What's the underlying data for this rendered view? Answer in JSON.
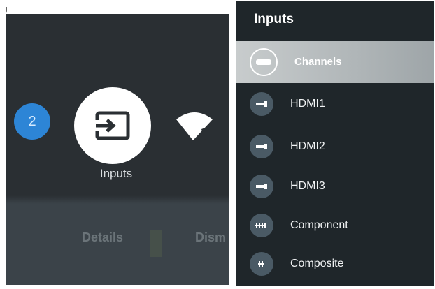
{
  "left_panel": {
    "badge_count": "2",
    "inputs_label": "Inputs",
    "details_label": "Details",
    "dismiss_label": "Dism",
    "top_strip_text": "j"
  },
  "right_panel": {
    "title": "Inputs",
    "selected_item": "Channels",
    "items": [
      {
        "label": "HDMI1",
        "icon": "hdmi-icon"
      },
      {
        "label": "HDMI2",
        "icon": "hdmi-icon"
      },
      {
        "label": "HDMI3",
        "icon": "hdmi-icon"
      },
      {
        "label": "Component",
        "icon": "component-icon"
      },
      {
        "label": "Composite",
        "icon": "composite-icon"
      }
    ]
  },
  "colors": {
    "left_bg": "#2a2f33",
    "right_bg": "#1f262a",
    "badge_blue": "#2d85d6",
    "selected_row": "#b8bec1",
    "row_icon_bg": "#4a5a65"
  }
}
